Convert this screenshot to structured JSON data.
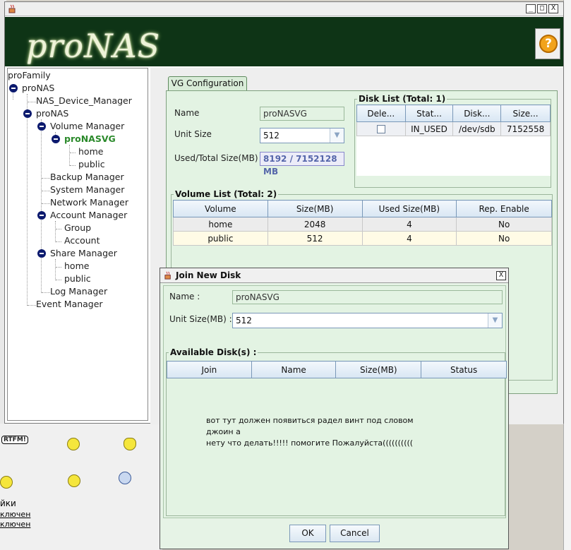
{
  "window": {
    "logo": "proNAS",
    "controls": {
      "minimize": "_",
      "maximize": "□",
      "close": "X"
    },
    "help_icon_label": "?"
  },
  "tree": {
    "root": "proFamily",
    "nodes": [
      {
        "label": "proNAS"
      },
      {
        "label": "NAS_Device_Manager"
      },
      {
        "label": "proNAS"
      },
      {
        "label": "Volume Manager"
      },
      {
        "label": "proNASVG"
      },
      {
        "label": "home"
      },
      {
        "label": "public"
      },
      {
        "label": "Backup Manager"
      },
      {
        "label": "System Manager"
      },
      {
        "label": "Network Manager"
      },
      {
        "label": "Account Manager"
      },
      {
        "label": "Group"
      },
      {
        "label": "Account"
      },
      {
        "label": "Share Manager"
      },
      {
        "label": "home"
      },
      {
        "label": "public"
      },
      {
        "label": "Log Manager"
      },
      {
        "label": "Event Manager"
      }
    ]
  },
  "vg": {
    "tab_label": "VG Configuration",
    "name_label": "Name",
    "name_value": "proNASVG",
    "unit_size_label": "Unit Size",
    "unit_size_value": "512",
    "used_total_label": "Used/Total Size(MB)",
    "used_total_value": "8192 / 7152128 MB",
    "disk_list": {
      "title": "Disk List (Total: 1)",
      "columns": [
        "Dele...",
        "Stat...",
        "Disk...",
        "Size..."
      ],
      "rows": [
        {
          "delete_checked": false,
          "status": "IN_USED",
          "disk": "/dev/sdb",
          "size": "7152558"
        }
      ]
    },
    "volume_list": {
      "title": "Volume List (Total: 2)",
      "columns": [
        "Volume",
        "Size(MB)",
        "Used Size(MB)",
        "Rep. Enable"
      ],
      "rows": [
        {
          "volume": "home",
          "size": "2048",
          "used": "4",
          "rep": "No"
        },
        {
          "volume": "public",
          "size": "512",
          "used": "4",
          "rep": "No"
        }
      ]
    }
  },
  "dialog": {
    "title": "Join New Disk",
    "close_label": "X",
    "name_label": "Name :",
    "name_value": "proNASVG",
    "unit_size_label": "Unit Size(MB) :",
    "unit_size_value": "512",
    "available_title": "Available Disk(s) :",
    "columns": [
      "Join",
      "Name",
      "Size(MB)",
      "Status"
    ],
    "message_line1": "вот тут должен появиться радел винт под словом джоин а",
    "message_line2": "нету что делать!!!!! помогите Пожалуйста((((((((((",
    "ok_label": "OK",
    "cancel_label": "Cancel"
  },
  "background": {
    "rtfm_label": "RTFM!",
    "settings_partial": "йки",
    "on_partial": "ключен",
    "off_partial": "ключен"
  },
  "colors": {
    "banner": "#0e3416",
    "panel_green": "#e3f3e3",
    "selected_tree": "#2b8a2b",
    "tree_toggle": "#0c1a6e"
  }
}
